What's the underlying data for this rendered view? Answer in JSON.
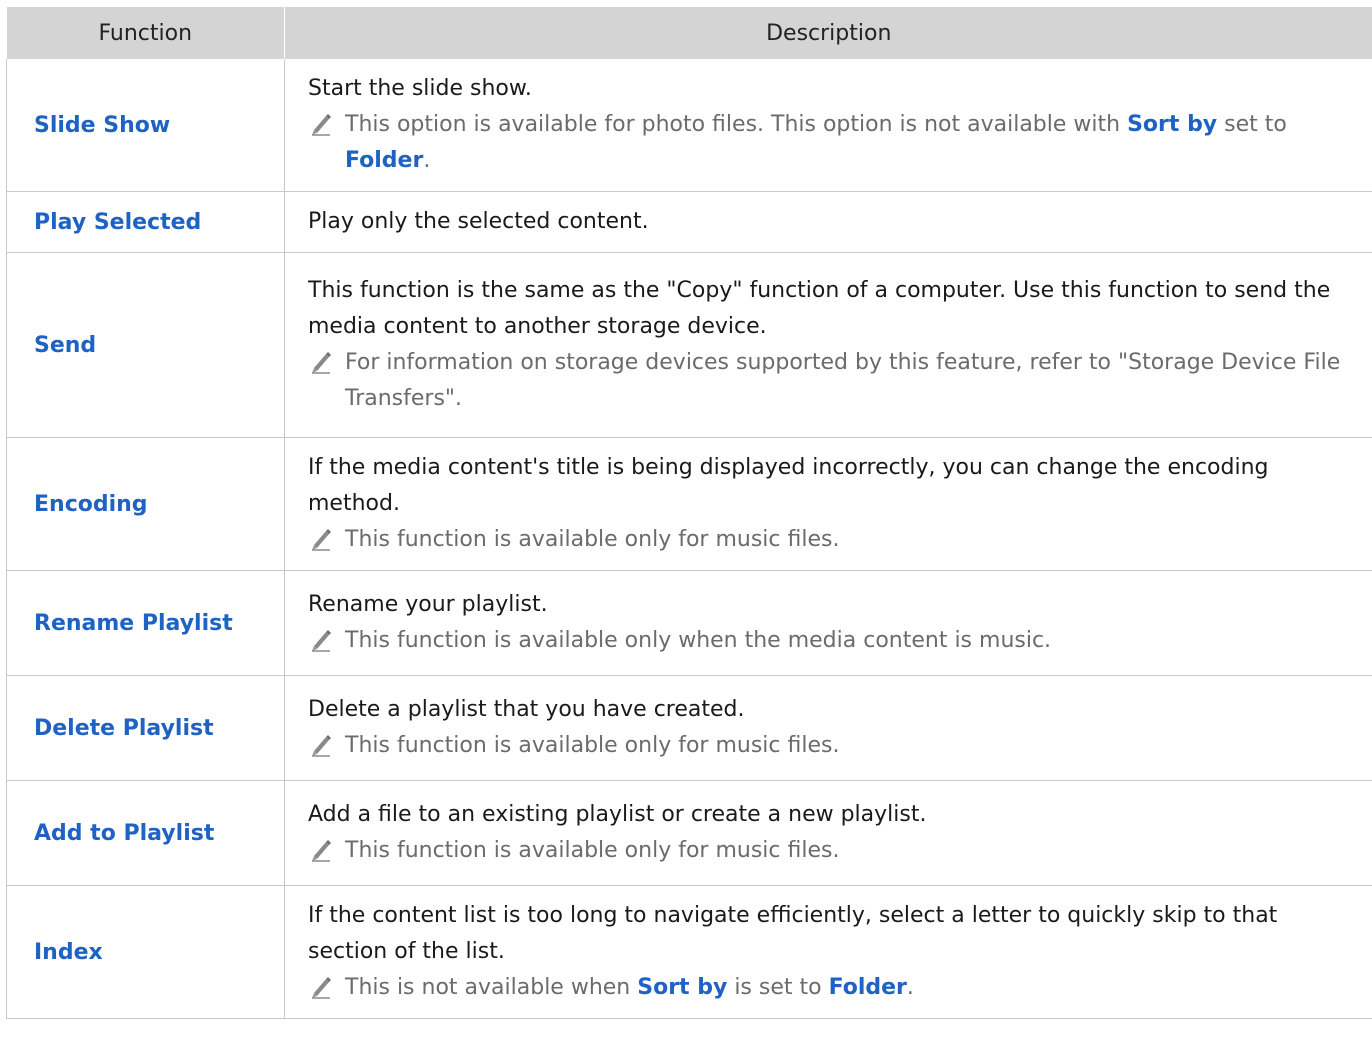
{
  "table": {
    "headers": [
      "Function",
      "Description"
    ],
    "rows": [
      {
        "function": "Slide Show",
        "main": "Start the slide show.",
        "note_parts": [
          {
            "text": "This option is available for photo files. This option is not available with "
          },
          {
            "text": "Sort by",
            "hl": true
          },
          {
            "text": " set to "
          },
          {
            "text": "Folder",
            "hl": true
          },
          {
            "text": "."
          }
        ]
      },
      {
        "function": "Play Selected",
        "main": "Play only the selected content."
      },
      {
        "function": "Send",
        "main": "This function is the same as the \"Copy\" function of a computer. Use this function to send the media content to another storage device.",
        "note_parts": [
          {
            "text": "For information on storage devices supported by this feature, refer to \"Storage Device File Transfers\"."
          }
        ]
      },
      {
        "function": "Encoding",
        "main": "If the media content's title is being displayed incorrectly, you can change the encoding method.",
        "note_parts": [
          {
            "text": "This function is available only for music files."
          }
        ]
      },
      {
        "function": "Rename Playlist",
        "main": "Rename your playlist.",
        "note_parts": [
          {
            "text": "This function is available only when the media content is music."
          }
        ]
      },
      {
        "function": "Delete Playlist",
        "main": "Delete a playlist that you have created.",
        "note_parts": [
          {
            "text": "This function is available only for music files."
          }
        ]
      },
      {
        "function": "Add to Playlist",
        "main": "Add a file to an existing playlist or create a new playlist.",
        "note_parts": [
          {
            "text": "This function is available only for music files."
          }
        ]
      },
      {
        "function": "Index",
        "main": "If the content list is too long to navigate efficiently, select a letter to quickly skip to that section of the list.",
        "note_parts": [
          {
            "text": "This is not available when "
          },
          {
            "text": "Sort by",
            "hl": true
          },
          {
            "text": " is set to "
          },
          {
            "text": "Folder",
            "hl": true
          },
          {
            "text": "."
          }
        ]
      }
    ]
  },
  "icons": {
    "note": "pencil-icon"
  },
  "colors": {
    "header_bg": "#d4d4d4",
    "highlight": "#1e63c4",
    "note_text": "#6b6b6b",
    "border": "#c8c8c8"
  }
}
